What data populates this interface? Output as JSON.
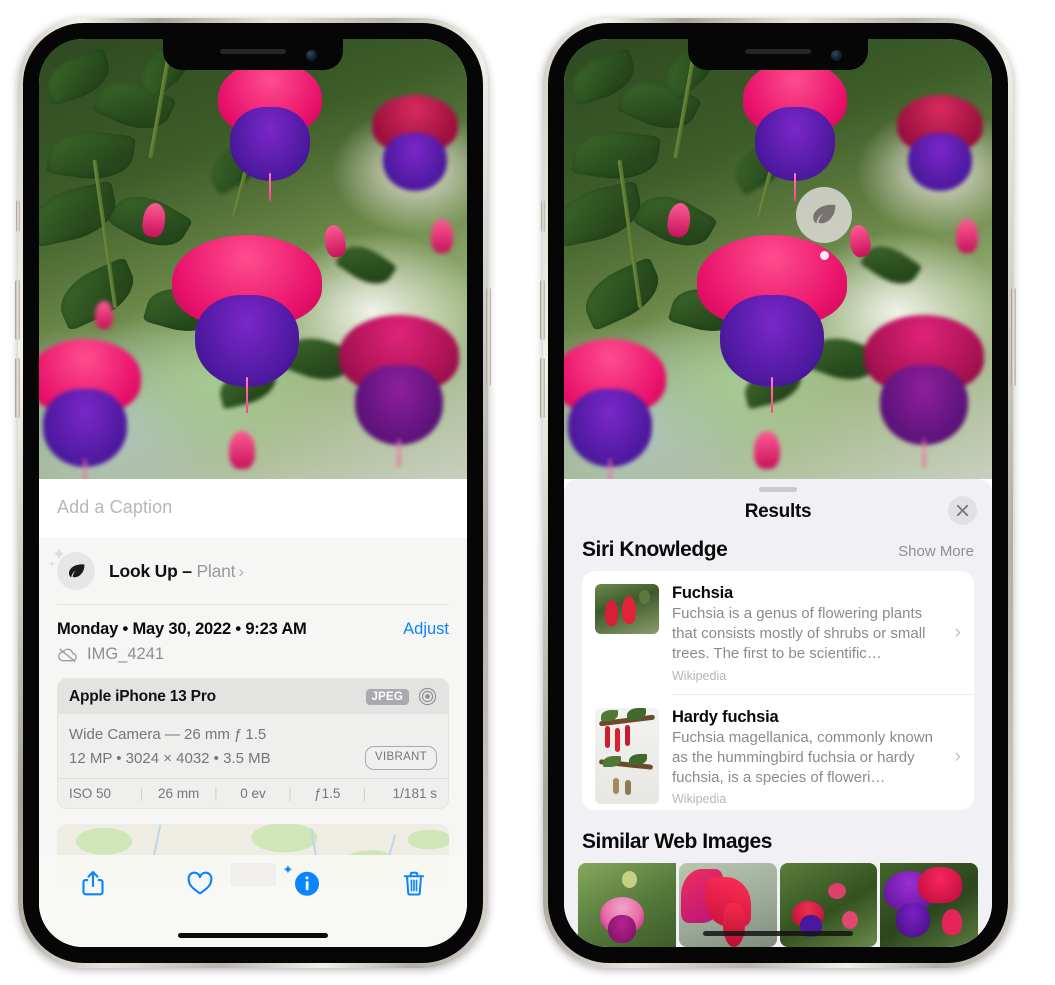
{
  "accent": {
    "blue": "#0a84ff",
    "sheet": "#f6f6f4",
    "results_sheet": "#f1f1f5"
  },
  "left_phone": {
    "caption": {
      "placeholder": "Add a Caption",
      "value": ""
    },
    "look_up": {
      "label": "Look Up",
      "dash": " – ",
      "subject": "Plant",
      "chevron": "›",
      "icon": "leaf-icon"
    },
    "meta": {
      "datetime": "Monday • May 30, 2022 • 9:23 AM",
      "adjust_label": "Adjust",
      "filename": "IMG_4241",
      "cloud_icon": "cloud-slash-icon"
    },
    "camera_card": {
      "model": "Apple iPhone 13 Pro",
      "format_badge": "JPEG",
      "aperture_icon": "aperture-icon",
      "lens_line": "Wide Camera — 26 mm ƒ 1.5",
      "specs_line": "12 MP  •  3024 × 4032  •  3.5 MB",
      "style_pill": "VIBRANT",
      "exif": [
        "ISO 50",
        "26 mm",
        "0 ev",
        "ƒ1.5",
        "1/181 s"
      ],
      "exif_separator": "|"
    },
    "map": {
      "pin_label": "photo-pin"
    },
    "toolbar": [
      {
        "name": "share-button",
        "icon": "share-icon"
      },
      {
        "name": "favorite-button",
        "icon": "heart-icon"
      },
      {
        "name": "info-button",
        "icon": "info-sparkle-icon"
      },
      {
        "name": "delete-button",
        "icon": "trash-icon"
      }
    ]
  },
  "right_phone": {
    "visual_look_up_badge": {
      "icon": "leaf-icon"
    },
    "sheet": {
      "title": "Results",
      "close_icon": "close-icon",
      "grabber": "drag-handle"
    },
    "siri_knowledge": {
      "title": "Siri Knowledge",
      "show_more": "Show More",
      "items": [
        {
          "title": "Fuchsia",
          "description": "Fuchsia is a genus of flowering plants that consists mostly of shrubs or small trees. The first to be scientific…",
          "source": "Wikipedia",
          "chevron": "›"
        },
        {
          "title": "Hardy fuchsia",
          "description": "Fuchsia magellanica, commonly known as the hummingbird fuchsia or hardy fuchsia, is a species of floweri…",
          "source": "Wikipedia",
          "chevron": "›"
        }
      ]
    },
    "similar_web_images": {
      "title": "Similar Web Images",
      "thumbnails": [
        "web-image-1",
        "web-image-2",
        "web-image-3",
        "web-image-4"
      ]
    }
  }
}
